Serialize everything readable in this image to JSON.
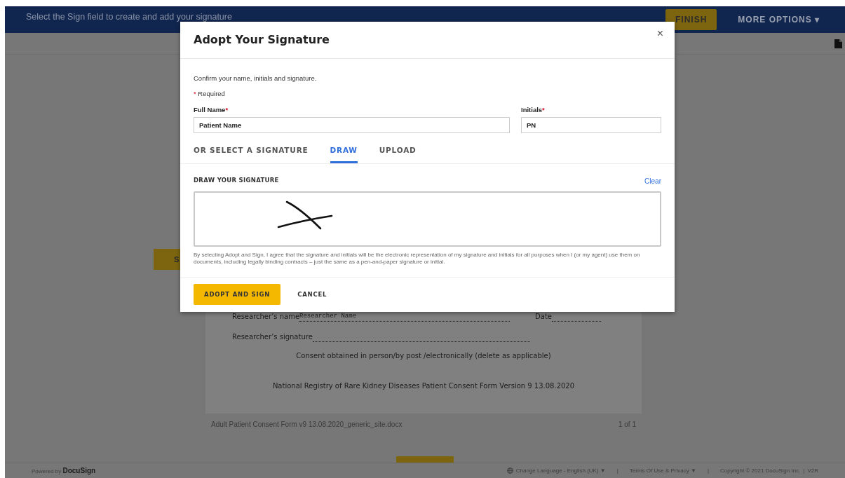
{
  "top_bar": {
    "message": "Select the Sign field to create and add your signature",
    "finish_button": "FINISH",
    "more_options": "MORE OPTIONS",
    "more_options_caret": "▾"
  },
  "sign_flag": "S",
  "document": {
    "lines": [
      {
        "kind": "field",
        "label": "Researcher’s name",
        "filled": "Researcher Name",
        "date_label": "Date"
      },
      {
        "kind": "field",
        "label": "Researcher’s signature"
      },
      {
        "kind": "center",
        "text": "Consent obtained in person/by post /electronically (delete as applicable)"
      },
      {
        "kind": "center",
        "text": "National Registry of Rare Kidney Diseases Patient Consent Form Version 9 13.08.2020"
      }
    ],
    "file_name": "Adult Patient Consent Form v9 13.08.2020_generic_site.docx",
    "page_count": "1 of 1"
  },
  "footer": {
    "powered_by": "Powered by",
    "brand": "DocuSign",
    "language": "Change Language - English (UK)",
    "language_caret": "▼",
    "separator_1": "|",
    "terms": "Terms Of Use & Privacy",
    "terms_caret": "▼",
    "separator_2": "|",
    "copyright": "Copyright © 2021 DocuSign Inc.",
    "separator_3": "|",
    "version": "V2R"
  },
  "modal": {
    "title": "Adopt Your Signature",
    "close": "×",
    "intro": "Confirm your name, initials and signature.",
    "required_mark": "*",
    "required_note": "Required",
    "fields": [
      {
        "label": "Full Name",
        "required": true,
        "value": "Patient Name"
      },
      {
        "label": "Initials",
        "required": true,
        "value": "PN"
      }
    ],
    "tabs": [
      {
        "label": "OR SELECT A SIGNATURE",
        "selected": false
      },
      {
        "label": "DRAW",
        "selected": true
      },
      {
        "label": "UPLOAD",
        "selected": false
      }
    ],
    "draw_heading": "DRAW YOUR SIGNATURE",
    "clear_link": "Clear",
    "legal_text": "By selecting Adopt and Sign, I agree that the signature and initials will be the electronic representation of my signature and initials for all purposes when I (or my agent) use them on documents, including legally binding contracts – just the same as a pen-and-paper signature or initial.",
    "buttons": [
      {
        "label": "ADOPT AND SIGN",
        "kind": "primary"
      },
      {
        "label": "CANCEL",
        "kind": "plain"
      }
    ]
  }
}
